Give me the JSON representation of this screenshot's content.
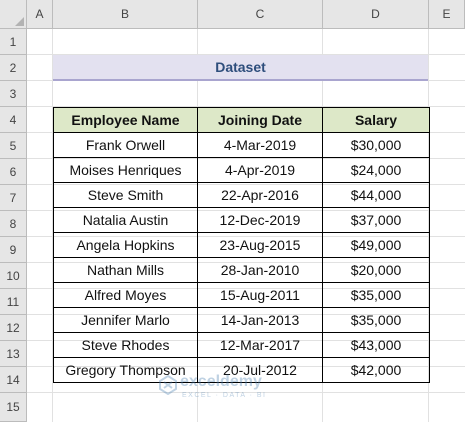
{
  "sheet": {
    "columns": [
      "A",
      "B",
      "C",
      "D",
      "E"
    ],
    "rows": [
      "1",
      "2",
      "3",
      "4",
      "5",
      "6",
      "7",
      "8",
      "9",
      "10",
      "11",
      "12",
      "13",
      "14",
      "15"
    ]
  },
  "title": "Dataset",
  "table": {
    "headers": [
      "Employee Name",
      "Joining Date",
      "Salary"
    ],
    "rows": [
      [
        "Frank Orwell",
        "4-Mar-2019",
        "$30,000"
      ],
      [
        "Moises Henriques",
        "4-Apr-2019",
        "$24,000"
      ],
      [
        "Steve Smith",
        "22-Apr-2016",
        "$44,000"
      ],
      [
        "Natalia Austin",
        "12-Dec-2019",
        "$37,000"
      ],
      [
        "Angela Hopkins",
        "23-Aug-2015",
        "$49,000"
      ],
      [
        "Nathan Mills",
        "28-Jan-2010",
        "$20,000"
      ],
      [
        "Alfred Moyes",
        "15-Aug-2011",
        "$35,000"
      ],
      [
        "Jennifer Marlo",
        "14-Jan-2013",
        "$35,000"
      ],
      [
        "Steve Rhodes",
        "12-Mar-2017",
        "$43,000"
      ],
      [
        "Gregory Thompson",
        "20-Jul-2012",
        "$42,000"
      ]
    ]
  },
  "watermark": {
    "name": "exceldemy",
    "tagline": "EXCEL · DATA · BI"
  },
  "colors": {
    "header_bg": "#e6e6e6",
    "title_band": "#e3e1f0",
    "title_text": "#2e4e7c",
    "table_header_bg": "#dde8c8"
  }
}
